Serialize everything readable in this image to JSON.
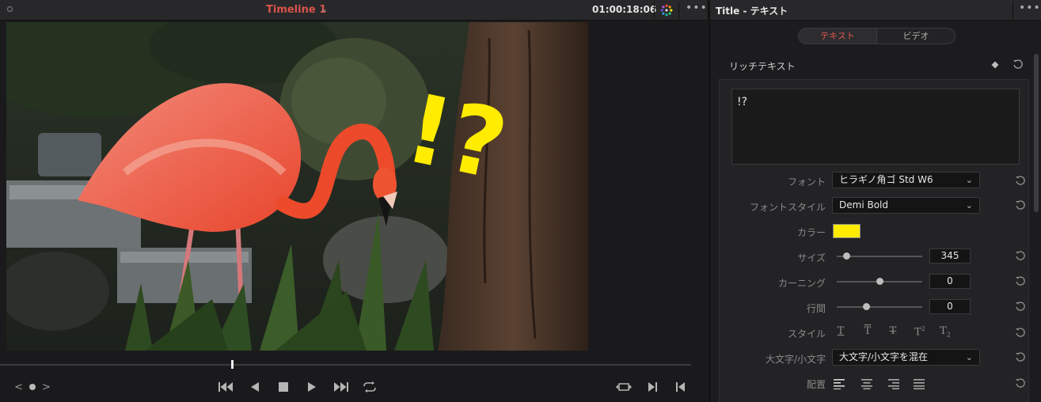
{
  "viewer": {
    "timeline_title": "Timeline 1",
    "timecode": "01:00:18:06",
    "overlay_text": "!?",
    "playhead_fraction": 0.335,
    "nav": {
      "prev": "<",
      "next": ">"
    }
  },
  "inspector": {
    "title": "Title - テキスト",
    "tabs": {
      "text": "テキスト",
      "video": "ビデオ"
    },
    "rich_text_label": "リッチテキスト",
    "text_value": "!?",
    "fields": {
      "font_label": "フォント",
      "font_value": "ヒラギノ角ゴ Std W6",
      "font_style_label": "フォントスタイル",
      "font_style_value": "Demi Bold",
      "color_label": "カラー",
      "color_value": "#ffec00",
      "size_label": "サイズ",
      "size_value": "345",
      "size_fraction": 0.08,
      "kerning_label": "カーニング",
      "kerning_value": "0",
      "kerning_fraction": 0.5,
      "leading_label": "行間",
      "leading_value": "0",
      "leading_fraction": 0.33,
      "style_label": "スタイル",
      "case_label": "大文字/小文字",
      "case_value": "大文字/小文字を混在",
      "align_label": "配置"
    }
  },
  "colors": {
    "accent_red": "#d9534a",
    "text_color_swatch": "#ffec00"
  },
  "icons": [
    "color-wheel-icon",
    "more-icon",
    "keyframe-diamond-icon",
    "reset-icon",
    "skip-back-icon",
    "play-reverse-icon",
    "stop-icon",
    "play-icon",
    "skip-forward-icon",
    "loop-icon",
    "match-frame-icon",
    "prev-edit-icon",
    "next-edit-icon"
  ]
}
